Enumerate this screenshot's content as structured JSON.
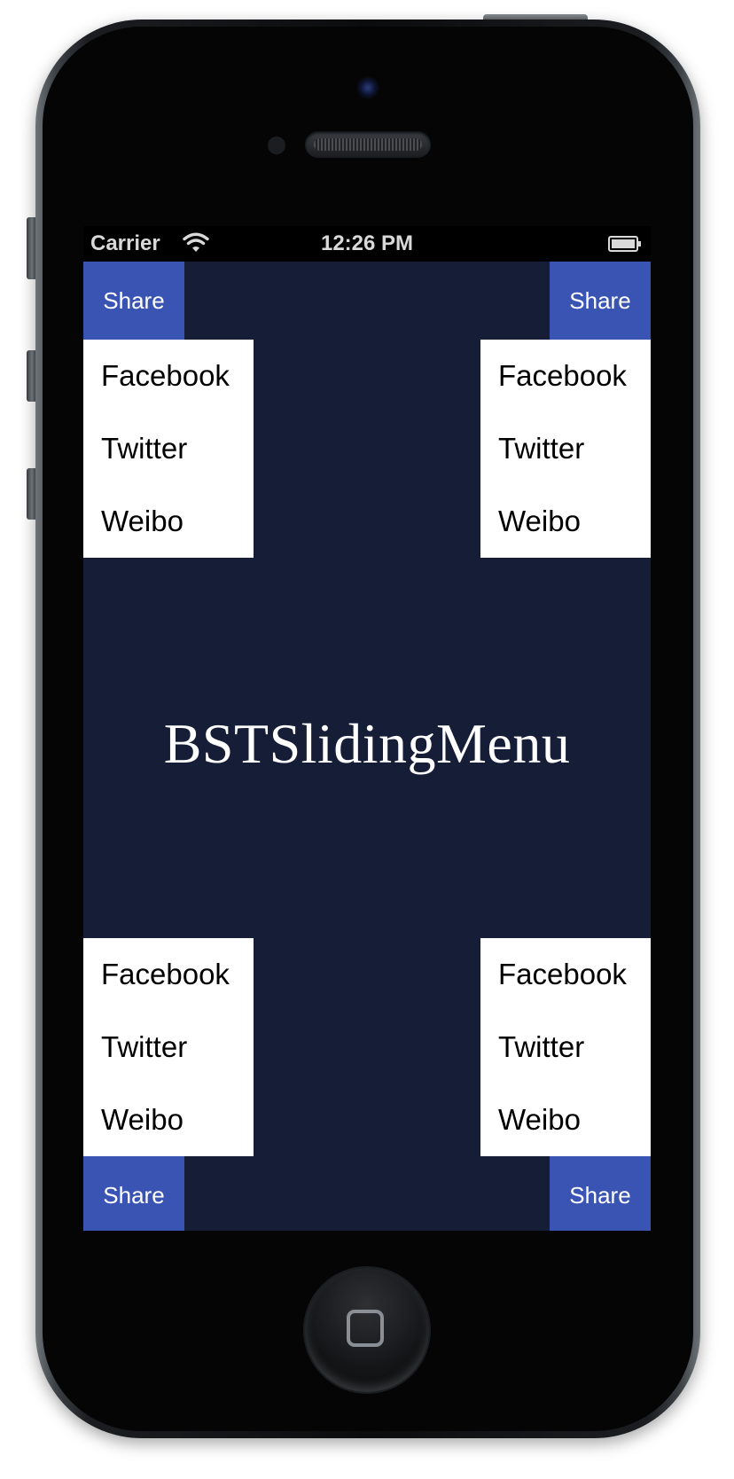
{
  "status_bar": {
    "carrier": "Carrier",
    "time": "12:26 PM",
    "wifi_icon": "wifi-icon",
    "battery_icon": "battery-icon"
  },
  "app": {
    "title": "BSTSlidingMenu",
    "background_color": "#161d36",
    "accent_color": "#3a54b4"
  },
  "menus": {
    "top_left": {
      "share_label": "Share",
      "items": [
        "Facebook",
        "Twitter",
        "Weibo"
      ]
    },
    "top_right": {
      "share_label": "Share",
      "items": [
        "Facebook",
        "Twitter",
        "Weibo"
      ]
    },
    "bottom_left": {
      "share_label": "Share",
      "items": [
        "Facebook",
        "Twitter",
        "Weibo"
      ]
    },
    "bottom_right": {
      "share_label": "Share",
      "items": [
        "Facebook",
        "Twitter",
        "Weibo"
      ]
    }
  }
}
